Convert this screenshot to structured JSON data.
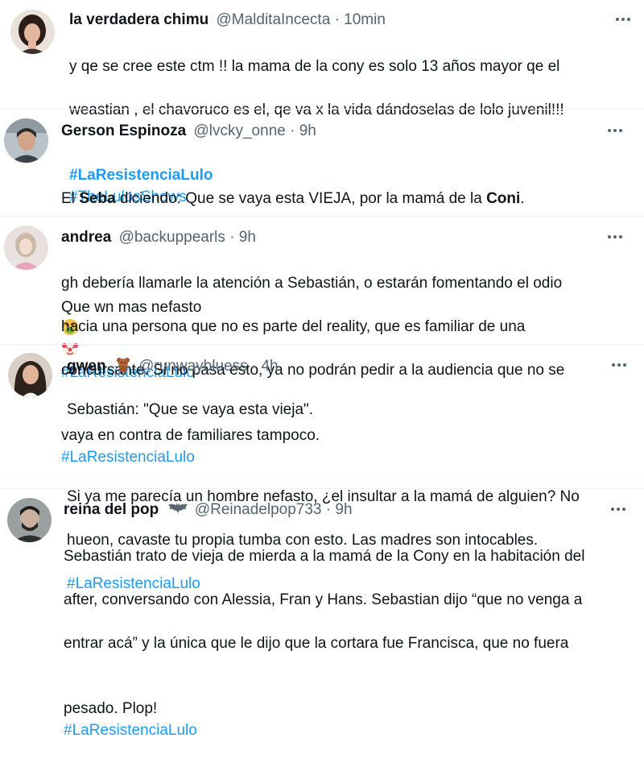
{
  "tweets": [
    {
      "name": "la verdadera chimu",
      "handle": "@MalditaIncecta",
      "sep": "·",
      "time": "10min",
      "avatar": "avatar-woman-icon",
      "lines": [
        "y qe se cree este ctm !! la mama de la cony es solo 13 años mayor qe el",
        "weastian , el chavoruco es el, qe va x la vida dándoselas de lolo juvenil!!!"
      ],
      "tags": [
        "#LaResistenciaLulo",
        "#TheLulosShows"
      ]
    },
    {
      "name": "Gerson Espinoza",
      "handle": "@lvcky_onne",
      "sep": "·",
      "time": "9h",
      "avatar": "avatar-man-icon",
      "line1_a": "El ",
      "line1_b": "Seba",
      "line1_c": " diciendo: Que se vaya esta VIEJA, por la mamá de la ",
      "line1_d": "Coni",
      "line1_e": ".",
      "line2": "Que wn mas nefasto",
      "emojis": [
        "vomiting-face-icon",
        "clown-face-icon"
      ],
      "tag": "#LaResistenciaLulo"
    },
    {
      "name": "andrea",
      "handle": "@backuppearls",
      "sep": "·",
      "time": "9h",
      "avatar": "avatar-girl-icon",
      "lines": [
        "gh debería llamarle la atención a Sebastián, o estarán fomentando el odio",
        "hacia una persona que no es parte del reality, que es familiar de una",
        "concursante. Si no pasa esto, ya no podrán pedir a la audiencia que no se",
        "vaya en contra de familiares tampoco."
      ],
      "tag": "#LaResistenciaLulo"
    },
    {
      "name": "gwen",
      "handle": "@runwaybluess",
      "sep": "·",
      "time": "4h",
      "avatar": "avatar-woman-dark-icon",
      "name_emoji": "teddy-bear-icon",
      "line1": "Sebastián: \"Que se vaya esta vieja\".",
      "lines": [
        "Si ya me parecía un hombre nefasto, ¿el insultar a la mamá de alguien? No",
        "hueon, cavaste tu propia tumba con esto. Las madres son intocables."
      ],
      "tag": "#LaResistenciaLulo"
    },
    {
      "name": "reina del pop",
      "handle": "@Reinadelpop733",
      "sep": "·",
      "time": "9h",
      "avatar": "avatar-man-beard-icon",
      "name_emoji": "bat-icon",
      "lines": [
        "Sebastián trato de vieja de mierda a la mamá de la Cony en la habitación del",
        "after, conversando con Alessia, Fran y Hans. Sebastian dijo “que no venga a",
        "entrar acá” y la única que le dijo que la cortara fue Francisca, que no fuera",
        "pesado. Plop!"
      ],
      "tag": "#LaResistenciaLulo"
    }
  ],
  "colors": {
    "text": "#0f1419",
    "muted": "#536471",
    "link": "#1d9bf0",
    "divider": "#eff3f4"
  }
}
